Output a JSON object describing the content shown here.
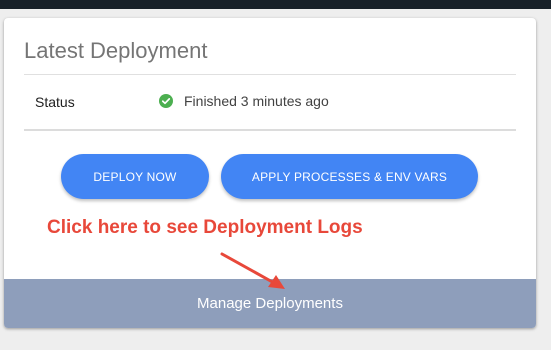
{
  "card": {
    "title": "Latest Deployment",
    "status_label": "Status",
    "status_value": "Finished 3 minutes ago",
    "status_icon": "check-circle-icon",
    "status_color": "#4caf50"
  },
  "buttons": {
    "deploy_now": "DEPLOY NOW",
    "apply_processes": "APPLY PROCESSES & ENV VARS"
  },
  "annotation": {
    "text": "Click here to see Deployment Logs",
    "color": "#e8483a"
  },
  "footer": {
    "label": "Manage Deployments"
  },
  "colors": {
    "accent": "#4285f4",
    "footer_bg": "#8e9ebb",
    "topbar": "#182129"
  }
}
